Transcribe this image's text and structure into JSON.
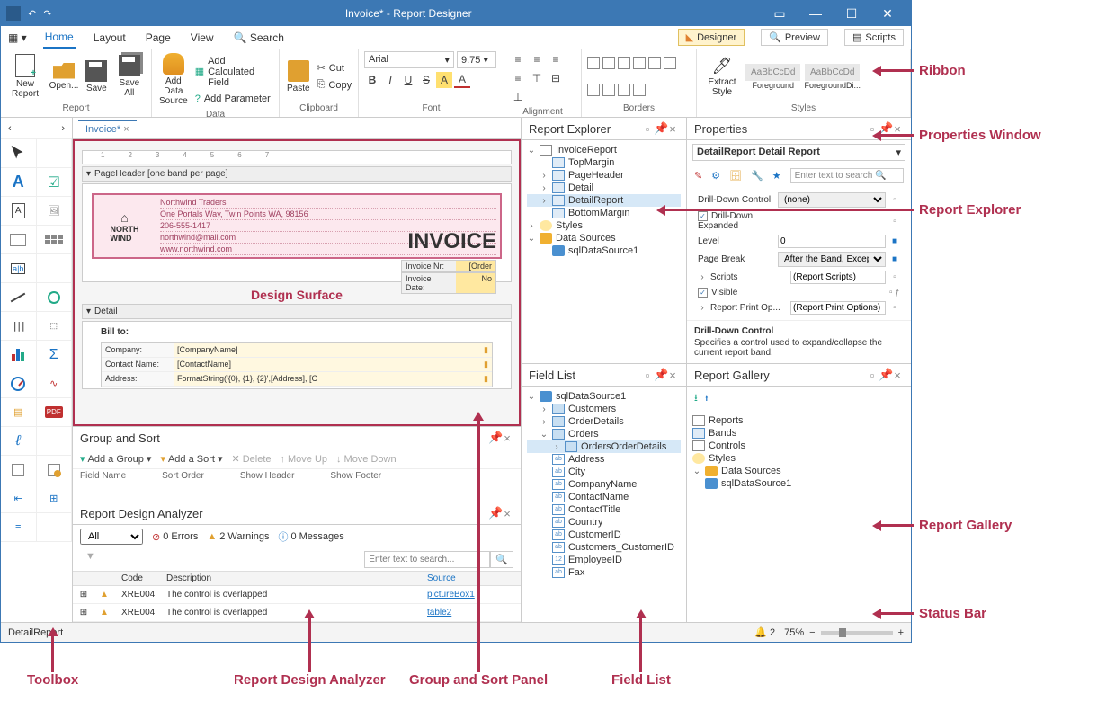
{
  "title": "Invoice* - Report Designer",
  "menus": {
    "home": "Home",
    "layout": "Layout",
    "page": "Page",
    "view": "View",
    "search": "Search"
  },
  "modeButtons": {
    "designer": "Designer",
    "preview": "Preview",
    "scripts": "Scripts"
  },
  "ribbon": {
    "newReport": "New Report",
    "open": "Open...",
    "save": "Save",
    "saveAll": "Save All",
    "addDataSource": "Add Data Source",
    "addCalcField": "Add Calculated Field",
    "addParam": "Add Parameter",
    "paste": "Paste",
    "cut": "Cut",
    "copy": "Copy",
    "font": "Arial",
    "fontSize": "9.75",
    "extractStyle": "Extract Style",
    "style1": "AaBbCcDd",
    "style1Name": "Foreground",
    "style2": "AaBbCcDd",
    "style2Name": "ForegroundDi...",
    "groups": {
      "report": "Report",
      "data": "Data",
      "clipboard": "Clipboard",
      "font": "Font",
      "alignment": "Alignment",
      "borders": "Borders",
      "styles": "Styles"
    }
  },
  "tab": "Invoice*",
  "design": {
    "pageHeader": "PageHeader [one band per page]",
    "detail": "Detail",
    "company": "Northwind Traders",
    "addr1": "One Portals Way, Twin Points WA, 98156",
    "phone": "206-555-1417",
    "email": "northwind@mail.com",
    "web": "www.northwind.com",
    "invoice": "INVOICE",
    "invNr": "Invoice Nr:",
    "invNrV": "[Order",
    "invDate": "Invoice Date:",
    "invDateV": "No",
    "label": "Design Surface",
    "billto": "Bill to:",
    "row1l": "Company:",
    "row1v": "[CompanyName]",
    "row2l": "Contact Name:",
    "row2v": "[ContactName]",
    "row3l": "Address:",
    "row3v": "FormatString('{0}, {1}, {2}',[Address], [C"
  },
  "groupSort": {
    "title": "Group and Sort",
    "addGroup": "Add a Group",
    "addSort": "Add a Sort",
    "delete": "Delete",
    "moveUp": "Move Up",
    "moveDown": "Move Down",
    "cols": {
      "field": "Field Name",
      "sort": "Sort Order",
      "showH": "Show Header",
      "showF": "Show Footer"
    }
  },
  "rda": {
    "title": "Report Design Analyzer",
    "all": "All",
    "errors": "0 Errors",
    "warnings": "2 Warnings",
    "messages": "0 Messages",
    "search": "Enter text to search...",
    "cols": {
      "code": "Code",
      "desc": "Description",
      "src": "Source"
    },
    "rows": [
      {
        "code": "XRE004",
        "desc": "The control is overlapped",
        "src": "pictureBox1"
      },
      {
        "code": "XRE004",
        "desc": "The control is overlapped",
        "src": "table2"
      }
    ]
  },
  "reportExplorer": {
    "title": "Report Explorer",
    "root": "InvoiceReport",
    "items": [
      "TopMargin",
      "PageHeader",
      "Detail",
      "DetailReport",
      "BottomMargin"
    ],
    "styles": "Styles",
    "dataSources": "Data Sources",
    "ds1": "sqlDataSource1"
  },
  "fieldList": {
    "title": "Field List",
    "root": "sqlDataSource1",
    "tables": [
      "Customers",
      "OrderDetails",
      "Orders"
    ],
    "ordersChild": "OrdersOrderDetails",
    "fields": [
      "Address",
      "City",
      "CompanyName",
      "ContactName",
      "ContactTitle",
      "Country",
      "CustomerID",
      "Customers_CustomerID",
      "EmployeeID",
      "Fax"
    ]
  },
  "properties": {
    "title": "Properties",
    "selection": "DetailReport  Detail Report",
    "search": "Enter text to search",
    "rows": {
      "ddc": "Drill-Down Control",
      "ddcV": "(none)",
      "dde": "Drill-Down Expanded",
      "level": "Level",
      "levelV": "0",
      "pb": "Page Break",
      "pbV": "After the Band, Except fo...",
      "scripts": "Scripts",
      "scriptsV": "(Report Scripts)",
      "visible": "Visible",
      "rpo": "Report Print Op...",
      "rpoV": "(Report Print Options)"
    },
    "desc": {
      "name": "Drill-Down Control",
      "text": "Specifies a control used to expand/collapse the current report band."
    }
  },
  "gallery": {
    "title": "Report Gallery",
    "items": [
      "Reports",
      "Bands",
      "Controls",
      "Styles",
      "Data Sources"
    ],
    "ds": "sqlDataSource1"
  },
  "status": {
    "left": "DetailReport",
    "bell": "2",
    "zoom": "75%"
  },
  "callouts": {
    "ribbon": "Ribbon",
    "propsWin": "Properties Window",
    "repExp": "Report Explorer",
    "repGal": "Report Gallery",
    "statusBar": "Status Bar",
    "toolbox": "Toolbox",
    "rda": "Report Design Analyzer",
    "gsp": "Group and Sort Panel",
    "fl": "Field List"
  }
}
